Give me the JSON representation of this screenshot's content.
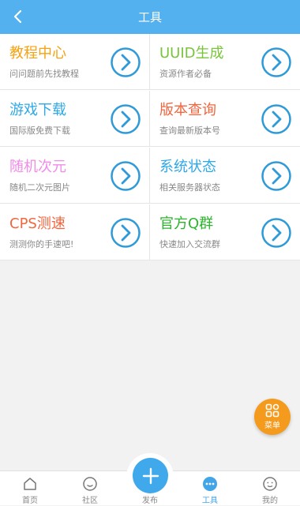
{
  "header": {
    "title": "工具",
    "back_icon": "chevron-left-icon"
  },
  "tools": [
    {
      "title": "教程中心",
      "subtitle": "问问题前先找教程",
      "color": "#f5a214"
    },
    {
      "title": "UUID生成",
      "subtitle": "资源作者必备",
      "color": "#79c43b"
    },
    {
      "title": "游戏下载",
      "subtitle": "国际版免费下载",
      "color": "#2ea8e6"
    },
    {
      "title": "版本查询",
      "subtitle": "查询最新版本号",
      "color": "#f0663f"
    },
    {
      "title": "随机次元",
      "subtitle": "随机二次元图片",
      "color": "#f28ae8"
    },
    {
      "title": "系统状态",
      "subtitle": "相关服务器状态",
      "color": "#2ea8e6"
    },
    {
      "title": "CPS测速",
      "subtitle": "测测你的手速吧!",
      "color": "#f0663f"
    },
    {
      "title": "官方Q群",
      "subtitle": "快速加入交流群",
      "color": "#2bb52b"
    }
  ],
  "arrow_color": "#2e9ad8",
  "fab": {
    "label": "菜单",
    "icon": "grid-icon",
    "color": "#f49a1c"
  },
  "bottom_nav": {
    "items": [
      {
        "label": "首页",
        "icon": "home-icon"
      },
      {
        "label": "社区",
        "icon": "smile-icon"
      },
      {
        "label": "发布",
        "icon": "plus-icon"
      },
      {
        "label": "工具",
        "icon": "more-icon"
      },
      {
        "label": "我的",
        "icon": "face-icon"
      }
    ],
    "active": "工具",
    "active_color": "#42a5e8"
  }
}
